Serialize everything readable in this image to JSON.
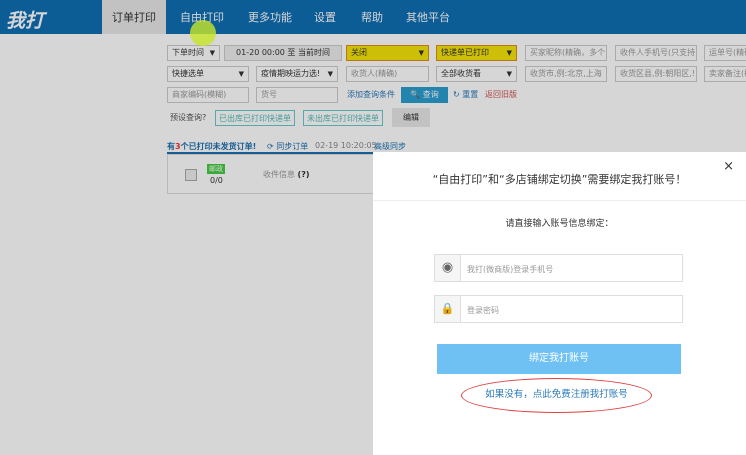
{
  "header": {
    "logo": "我打",
    "tabs": [
      "订单打印",
      "自由打印",
      "更多功能",
      "设置",
      "帮助",
      "其他平台"
    ]
  },
  "filters": {
    "time_type": "下单时间",
    "time_range": "01-20 00:00 至 当前时间",
    "close_status": "关闭",
    "print_status": "快递单已打印",
    "buyer_nick": "买家昵称(精确，多个",
    "receiver_phone": "收件人手机号(只支持",
    "waybill_no": "运单号(精确",
    "express": "快捷选单",
    "epidemic": "疫情期映运力选!",
    "receiver_name": "收货人(精确)",
    "all_receivers": "全部收货看",
    "city": "收货市,例:北京,上海",
    "district": "收货区县,例:朝阳区,!",
    "seller_memo": "卖家备注(模",
    "merchant_code": "商家编码(模糊)",
    "goods_no": "货号",
    "add_condition": "添加查询条件",
    "search": "查询",
    "reset": "重置",
    "back_old": "返回旧版"
  },
  "presets": {
    "label": "预设查询",
    "items": [
      "已出库已打印快递单",
      "未出库已打印快递单"
    ],
    "edit": "编辑"
  },
  "status": {
    "prefix": "有",
    "count": "3",
    "suffix": "个已打印未发货订单!",
    "sync": "同步订单",
    "sync_time": "02-19 10:20:05",
    "advanced_sync": "高级同步"
  },
  "order": {
    "badge": "邮政",
    "count": "0/0",
    "receiver": "收件信息",
    "help": "(?)"
  },
  "modal": {
    "title": "“自由打印”和“多店铺绑定切换”需要绑定我打账号！",
    "subtitle": "请直接输入账号信息绑定：",
    "phone_placeholder": "我打(微商版)登录手机号",
    "password_placeholder": "登录密码",
    "bind_button": "绑定我打账号",
    "register_link": "如果没有，点此免费注册我打账号",
    "close": "×"
  }
}
